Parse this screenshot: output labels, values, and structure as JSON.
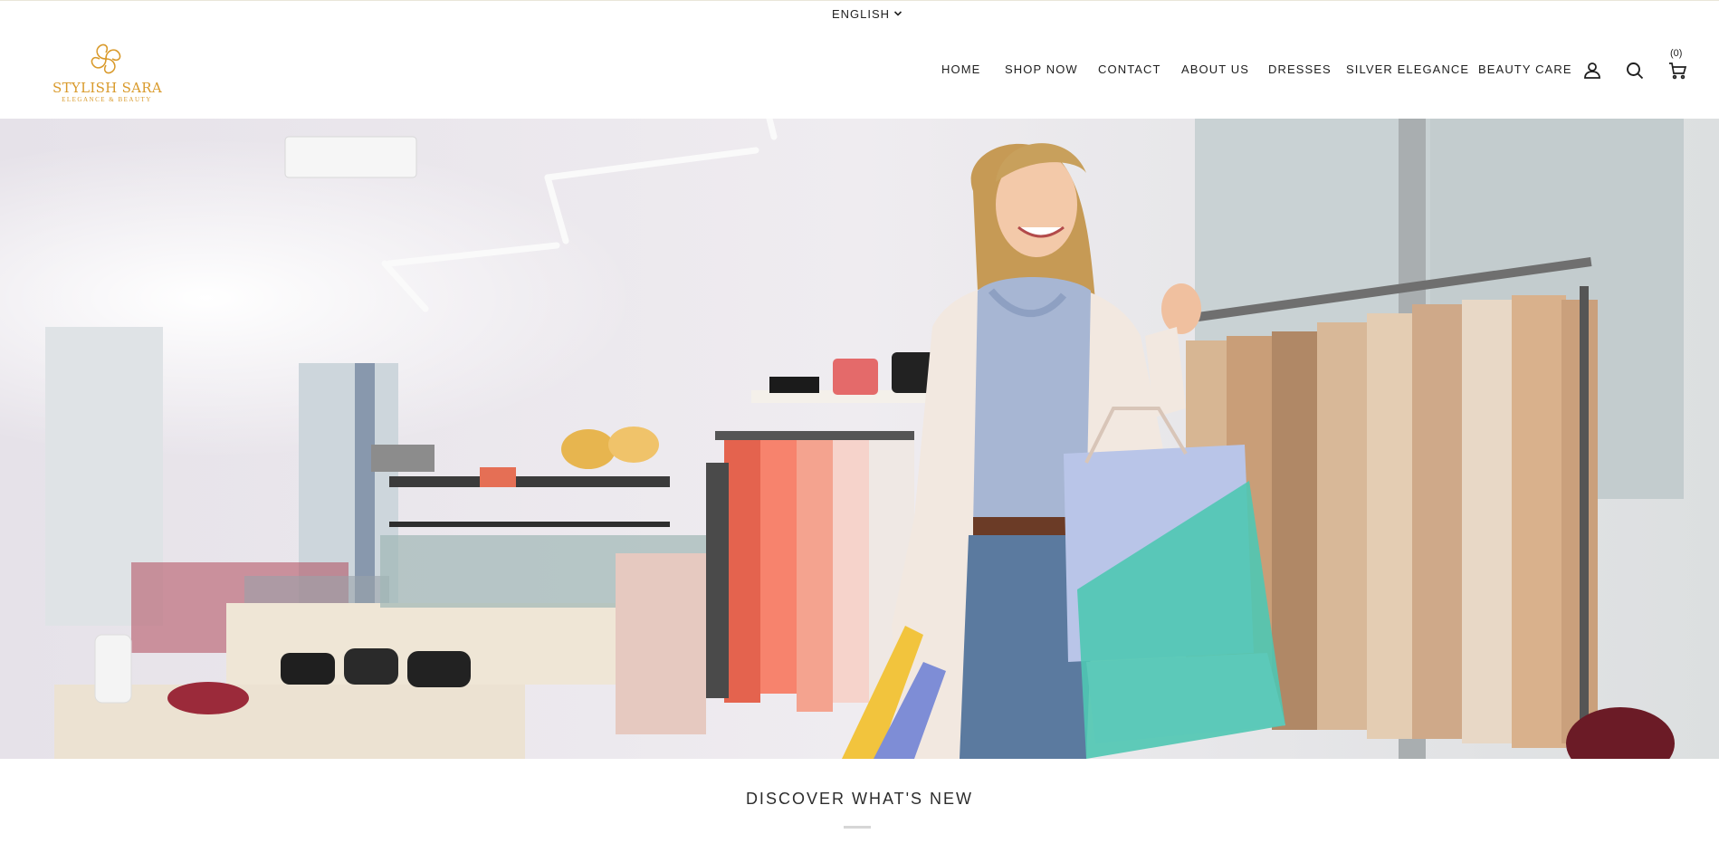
{
  "language": {
    "label": "ENGLISH"
  },
  "brand": {
    "name": "STYLISH SARA",
    "tagline": "ELEGANCE & BEAUTY",
    "color": "#d99a2b"
  },
  "nav": {
    "items": [
      {
        "label": "HOME"
      },
      {
        "label": "SHOP NOW"
      },
      {
        "label": "CONTACT"
      },
      {
        "label": "ABOUT US"
      },
      {
        "label": "DRESSES"
      },
      {
        "label": "SILVER ELEGANCE"
      },
      {
        "label": "BEAUTY CARE"
      }
    ],
    "icons": [
      "account-icon",
      "search-icon",
      "cart-icon"
    ],
    "cart_count": "(0)"
  },
  "hero": {
    "alt": "Smiling woman with shopping bags in a clothing boutique"
  },
  "section": {
    "title": "DISCOVER WHAT'S NEW"
  }
}
